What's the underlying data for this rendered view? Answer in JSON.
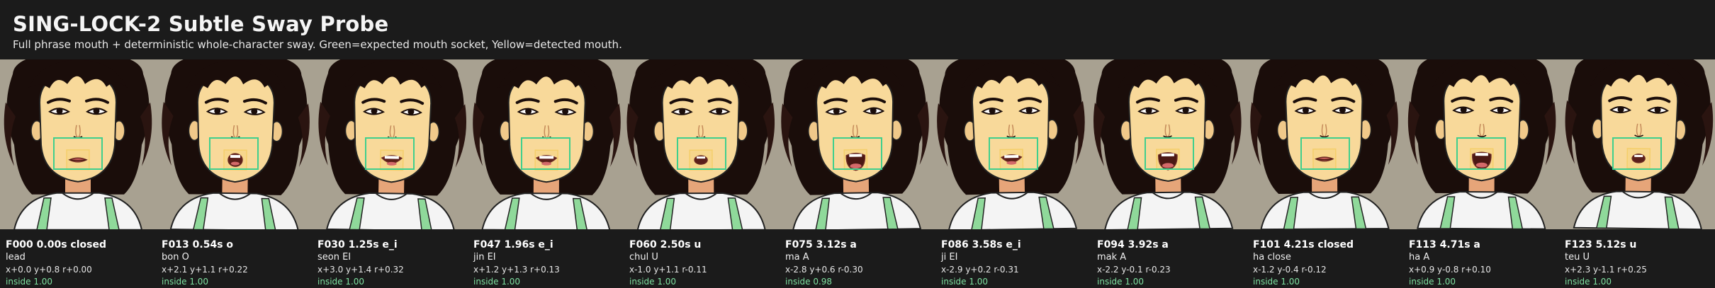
{
  "header": {
    "title": "SING-LOCK-2 Subtle Sway Probe",
    "subtitle": "Full phrase mouth + deterministic whole-character sway. Green=expected mouth socket, Yellow=detected mouth."
  },
  "colors": {
    "background": "#1b1b1b",
    "expected_socket": "#3fcf8e",
    "detected_mouth": "#f2c94c",
    "inside_text": "#7ee0a0"
  },
  "frames": [
    {
      "frame": "F000 0.00s closed",
      "lyric": "lead",
      "offset": "x+0.0 y+0.8 r+0.00",
      "inside": "inside 1.00",
      "mouth": "closed",
      "dx": 0.0,
      "dy": 0.8,
      "r": 0.0
    },
    {
      "frame": "F013 0.54s o",
      "lyric": "bon O",
      "offset": "x+2.1 y+1.1 r+0.22",
      "inside": "inside 1.00",
      "mouth": "o",
      "dx": 2.1,
      "dy": 1.1,
      "r": 0.22
    },
    {
      "frame": "F030 1.25s e_i",
      "lyric": "seon EI",
      "offset": "x+3.0 y+1.4 r+0.32",
      "inside": "inside 1.00",
      "mouth": "e_i",
      "dx": 3.0,
      "dy": 1.4,
      "r": 0.32
    },
    {
      "frame": "F047 1.96s e_i",
      "lyric": "jin EI",
      "offset": "x+1.2 y+1.3 r+0.13",
      "inside": "inside 1.00",
      "mouth": "e_i",
      "dx": 1.2,
      "dy": 1.3,
      "r": 0.13
    },
    {
      "frame": "F060 2.50s u",
      "lyric": "chul U",
      "offset": "x-1.0 y+1.1 r-0.11",
      "inside": "inside 1.00",
      "mouth": "u",
      "dx": -1.0,
      "dy": 1.1,
      "r": -0.11
    },
    {
      "frame": "F075 3.12s a",
      "lyric": "ma A",
      "offset": "x-2.8 y+0.6 r-0.30",
      "inside": "inside 0.98",
      "mouth": "a",
      "dx": -2.8,
      "dy": 0.6,
      "r": -0.3
    },
    {
      "frame": "F086 3.58s e_i",
      "lyric": "ji EI",
      "offset": "x-2.9 y+0.2 r-0.31",
      "inside": "inside 1.00",
      "mouth": "e_i",
      "dx": -2.9,
      "dy": 0.2,
      "r": -0.31
    },
    {
      "frame": "F094 3.92s a",
      "lyric": "mak A",
      "offset": "x-2.2 y-0.1 r-0.23",
      "inside": "inside 1.00",
      "mouth": "a",
      "dx": -2.2,
      "dy": -0.1,
      "r": -0.23
    },
    {
      "frame": "F101 4.21s closed",
      "lyric": "ha close",
      "offset": "x-1.2 y-0.4 r-0.12",
      "inside": "inside 1.00",
      "mouth": "closed",
      "dx": -1.2,
      "dy": -0.4,
      "r": -0.12
    },
    {
      "frame": "F113 4.71s a",
      "lyric": "ha A",
      "offset": "x+0.9 y-0.8 r+0.10",
      "inside": "inside 1.00",
      "mouth": "a",
      "dx": 0.9,
      "dy": -0.8,
      "r": 0.1
    },
    {
      "frame": "F123 5.12s u",
      "lyric": "teu U",
      "offset": "x+2.3 y-1.1 r+0.25",
      "inside": "inside 1.00",
      "mouth": "u",
      "dx": 2.3,
      "dy": -1.1,
      "r": 0.25
    }
  ]
}
